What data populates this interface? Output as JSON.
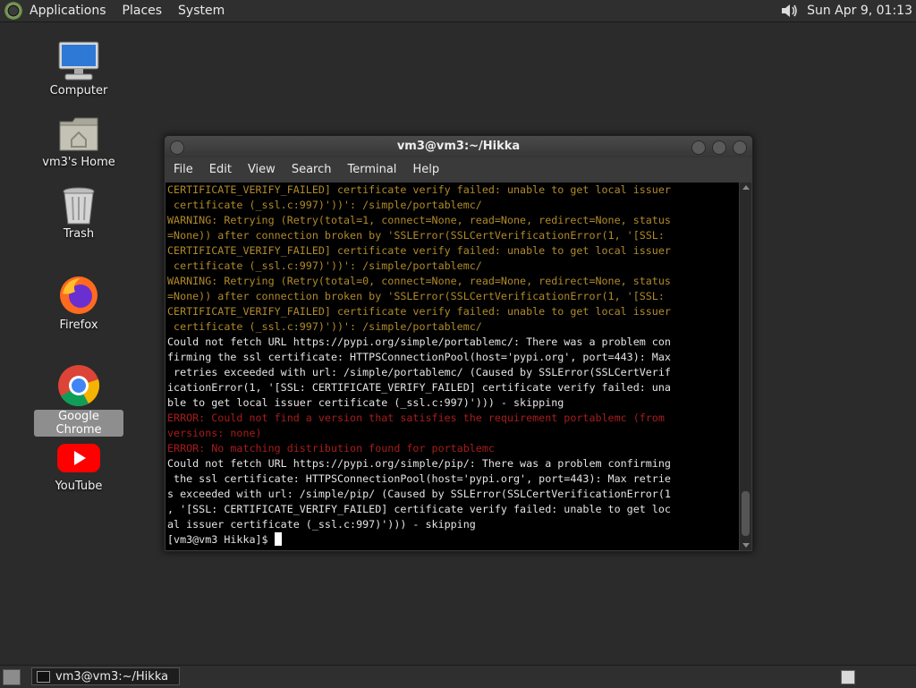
{
  "top_panel": {
    "menus": [
      "Applications",
      "Places",
      "System"
    ],
    "clock": "Sun Apr  9, 01:13"
  },
  "desktop_icons": [
    {
      "label": "Computer",
      "icon": "computer-icon"
    },
    {
      "label": "vm3's Home",
      "icon": "home-folder-icon"
    },
    {
      "label": "Trash",
      "icon": "trash-icon"
    },
    {
      "label": "Firefox",
      "icon": "firefox-icon"
    },
    {
      "label": "Google Chrome",
      "icon": "chrome-icon"
    },
    {
      "label": "YouTube",
      "icon": "youtube-icon"
    }
  ],
  "terminal": {
    "title": "vm3@vm3:~/Hikka",
    "menu": [
      "File",
      "Edit",
      "View",
      "Search",
      "Terminal",
      "Help"
    ],
    "lines": [
      {
        "text": "CERTIFICATE_VERIFY_FAILED] certificate verify failed: unable to get local issuer",
        "kind": "warn"
      },
      {
        "text": " certificate (_ssl.c:997)'))': /simple/portablemc/",
        "kind": "warn"
      },
      {
        "text": "WARNING: Retrying (Retry(total=1, connect=None, read=None, redirect=None, status",
        "kind": "warn"
      },
      {
        "text": "=None)) after connection broken by 'SSLError(SSLCertVerificationError(1, '[SSL:",
        "kind": "warn"
      },
      {
        "text": "CERTIFICATE_VERIFY_FAILED] certificate verify failed: unable to get local issuer",
        "kind": "warn"
      },
      {
        "text": " certificate (_ssl.c:997)'))': /simple/portablemc/",
        "kind": "warn"
      },
      {
        "text": "WARNING: Retrying (Retry(total=0, connect=None, read=None, redirect=None, status",
        "kind": "warn"
      },
      {
        "text": "=None)) after connection broken by 'SSLError(SSLCertVerificationError(1, '[SSL:",
        "kind": "warn"
      },
      {
        "text": "CERTIFICATE_VERIFY_FAILED] certificate verify failed: unable to get local issuer",
        "kind": "warn"
      },
      {
        "text": " certificate (_ssl.c:997)'))': /simple/portablemc/",
        "kind": "warn"
      },
      {
        "text": "Could not fetch URL https://pypi.org/simple/portablemc/: There was a problem con",
        "kind": "normal"
      },
      {
        "text": "firming the ssl certificate: HTTPSConnectionPool(host='pypi.org', port=443): Max",
        "kind": "normal"
      },
      {
        "text": " retries exceeded with url: /simple/portablemc/ (Caused by SSLError(SSLCertVerif",
        "kind": "normal"
      },
      {
        "text": "icationError(1, '[SSL: CERTIFICATE_VERIFY_FAILED] certificate verify failed: una",
        "kind": "normal"
      },
      {
        "text": "ble to get local issuer certificate (_ssl.c:997)'))) - skipping",
        "kind": "normal"
      },
      {
        "text": "ERROR: Could not find a version that satisfies the requirement portablemc (from",
        "kind": "err"
      },
      {
        "text": "versions: none)",
        "kind": "err"
      },
      {
        "text": "ERROR: No matching distribution found for portablemc",
        "kind": "err"
      },
      {
        "text": "Could not fetch URL https://pypi.org/simple/pip/: There was a problem confirming",
        "kind": "normal"
      },
      {
        "text": " the ssl certificate: HTTPSConnectionPool(host='pypi.org', port=443): Max retrie",
        "kind": "normal"
      },
      {
        "text": "s exceeded with url: /simple/pip/ (Caused by SSLError(SSLCertVerificationError(1",
        "kind": "normal"
      },
      {
        "text": ", '[SSL: CERTIFICATE_VERIFY_FAILED] certificate verify failed: unable to get loc",
        "kind": "normal"
      },
      {
        "text": "al issuer certificate (_ssl.c:997)'))) - skipping",
        "kind": "normal"
      }
    ],
    "prompt": "[vm3@vm3 Hikka]$ "
  },
  "taskbar": {
    "task_label": "vm3@vm3:~/Hikka"
  }
}
